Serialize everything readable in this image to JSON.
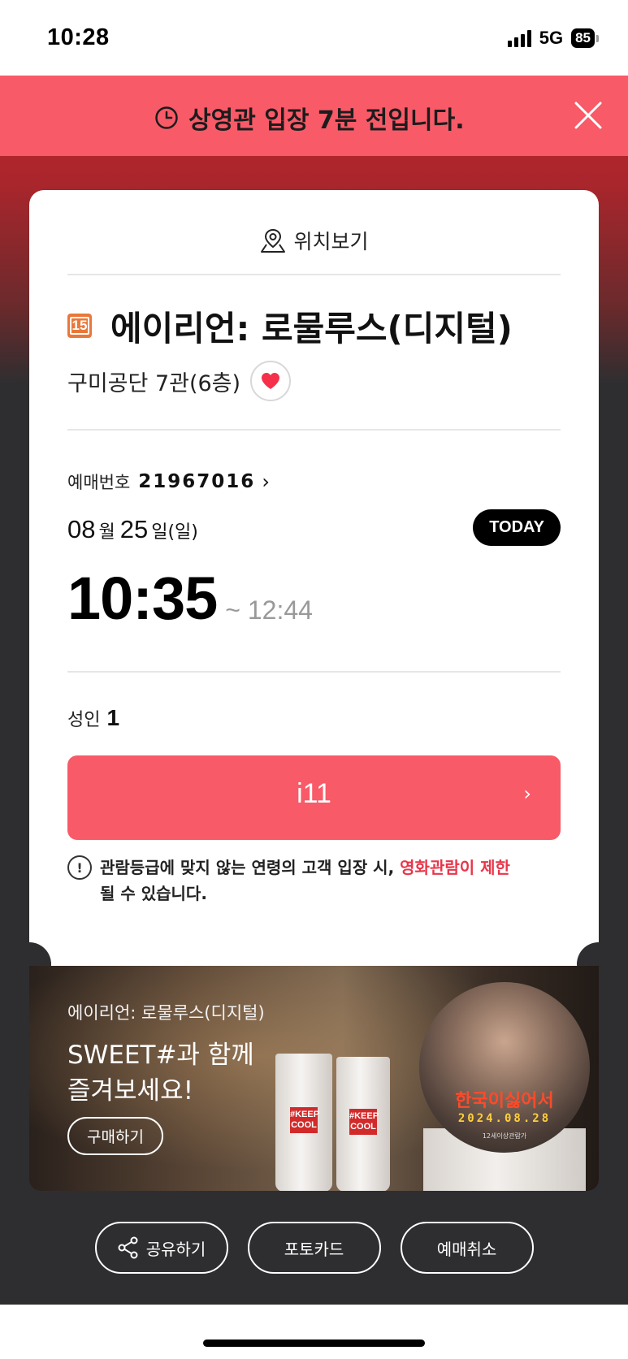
{
  "status_bar": {
    "time": "10:28",
    "network": "5G",
    "battery": "85"
  },
  "banner": {
    "message": "상영관 입장 7분 전입니다."
  },
  "ticket": {
    "location_label": "위치보기",
    "rating": "15",
    "movie_title": "에이리언: 로물루스(디지털)",
    "theater": "구미공단 7관(6층)",
    "booking_label": "예매번호",
    "booking_number": "21967016",
    "date": {
      "month": "08",
      "month_unit": "월",
      "day": "25",
      "day_unit": "일",
      "weekday": "(일)"
    },
    "today_badge": "TODAY",
    "time_start": "10:35",
    "time_end": "~ 12:44",
    "audience_label": "성인",
    "audience_count": "1",
    "seat": "i11",
    "notice_pre": "관람등급에 맞지 않는 연령의 고객 입장 시, ",
    "notice_highlight": "영화관람이 제한",
    "notice_post": "될 수 있습니다."
  },
  "promo": {
    "subtitle": "에이리언: 로물루스(디지털)",
    "title_line1": "SWEET#과 함께",
    "title_line2": "즐겨보세요!",
    "buy_label": "구매하기",
    "cup_logo": "#KEEP COOL",
    "poster_title": "한국이싫어서",
    "poster_date": "2024.08.28",
    "poster_small": "12세이상관람가"
  },
  "actions": {
    "share": "공유하기",
    "photocard": "포토카드",
    "cancel": "예매취소"
  },
  "colors": {
    "accent": "#f85a68",
    "highlight": "#e8364a",
    "background": "#2e2e30"
  }
}
